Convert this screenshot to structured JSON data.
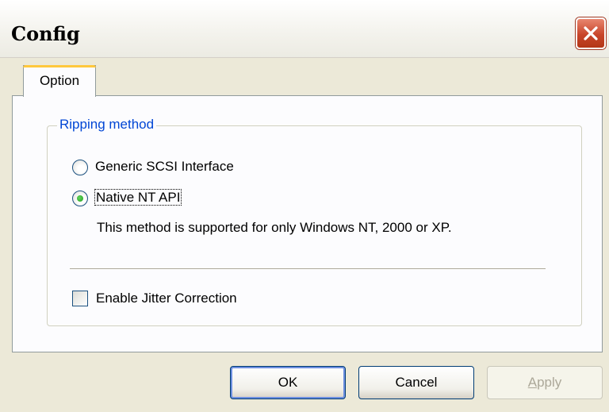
{
  "window": {
    "title": "Config",
    "close_icon": "close-icon",
    "accent_color": "#c8452a"
  },
  "tabs": [
    {
      "label": "Option",
      "selected": true
    }
  ],
  "ripping_method": {
    "title": "Ripping method",
    "options": [
      {
        "label": "Generic SCSI Interface",
        "selected": false
      },
      {
        "label": "Native NT API",
        "selected": true
      }
    ],
    "note": "This method is supported for only Windows NT, 2000 or XP."
  },
  "jitter": {
    "label": "Enable Jitter Correction",
    "checked": false
  },
  "buttons": {
    "ok": "OK",
    "cancel": "Cancel",
    "apply": "Apply",
    "apply_enabled": false
  }
}
